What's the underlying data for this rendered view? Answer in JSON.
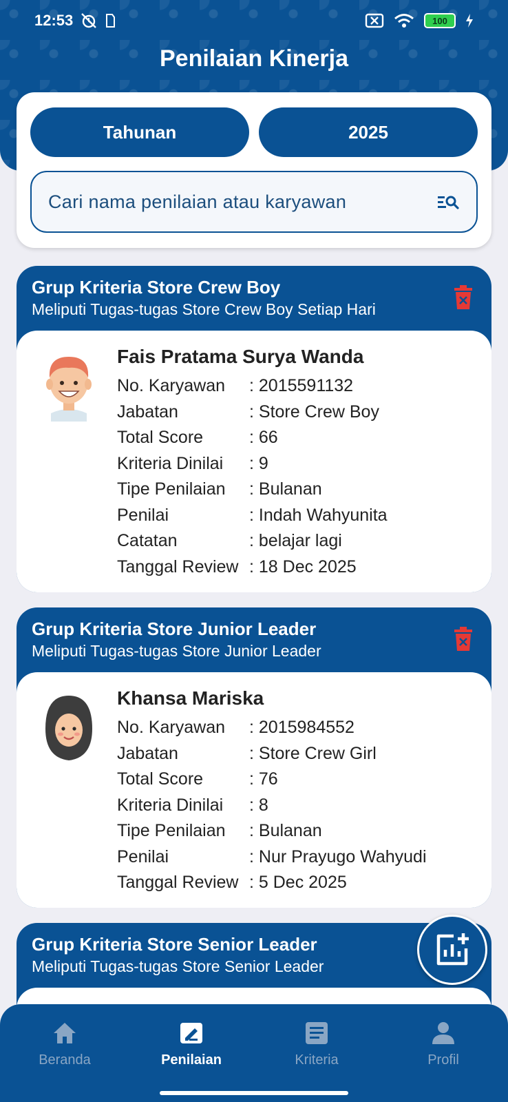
{
  "status_bar": {
    "time": "12:53",
    "battery": "100"
  },
  "page_title": "Penilaian Kinerja",
  "filters": {
    "period_label": "Tahunan",
    "year_label": "2025"
  },
  "search": {
    "placeholder": "Cari nama penilaian atau karyawan"
  },
  "groups": [
    {
      "title": "Grup Kriteria Store Crew Boy",
      "subtitle": "Meliputi Tugas-tugas Store Crew Boy Setiap Hari",
      "employee": {
        "name": "Fais Pratama Surya Wanda",
        "fields": [
          {
            "label": "No. Karyawan",
            "value": ": 2015591132"
          },
          {
            "label": "Jabatan",
            "value": ": Store Crew Boy"
          },
          {
            "label": "Total Score",
            "value": ": 66"
          },
          {
            "label": "Kriteria Dinilai",
            "value": ": 9"
          },
          {
            "label": "Tipe Penilaian",
            "value": ": Bulanan"
          },
          {
            "label": "Penilai",
            "value": ": Indah Wahyunita"
          },
          {
            "label": "Catatan",
            "value": ": belajar lagi"
          },
          {
            "label": "Tanggal Review",
            "value": ": 18 Dec 2025"
          }
        ]
      }
    },
    {
      "title": "Grup Kriteria Store Junior Leader",
      "subtitle": "Meliputi Tugas-tugas Store Junior Leader",
      "employee": {
        "name": "Khansa Mariska",
        "fields": [
          {
            "label": "No. Karyawan",
            "value": ": 2015984552"
          },
          {
            "label": "Jabatan",
            "value": ": Store Crew Girl"
          },
          {
            "label": "Total Score",
            "value": ": 76"
          },
          {
            "label": "Kriteria Dinilai",
            "value": ": 8"
          },
          {
            "label": "Tipe Penilaian",
            "value": ": Bulanan"
          },
          {
            "label": "Penilai",
            "value": ": Nur Prayugo Wahyudi"
          },
          {
            "label": "Tanggal Review",
            "value": ": 5 Dec 2025"
          }
        ]
      }
    },
    {
      "title": "Grup Kriteria Store Senior Leader",
      "subtitle": "Meliputi Tugas-tugas Store Senior Leader"
    }
  ],
  "nav": {
    "items": [
      {
        "label": "Beranda",
        "icon": "home-icon"
      },
      {
        "label": "Penilaian",
        "icon": "rating-edit-icon",
        "active": true
      },
      {
        "label": "Kriteria",
        "icon": "list-document-icon"
      },
      {
        "label": "Profil",
        "icon": "person-icon"
      }
    ]
  },
  "colors": {
    "primary": "#0a5294",
    "delete": "#e53935",
    "background": "#eeeef4"
  }
}
